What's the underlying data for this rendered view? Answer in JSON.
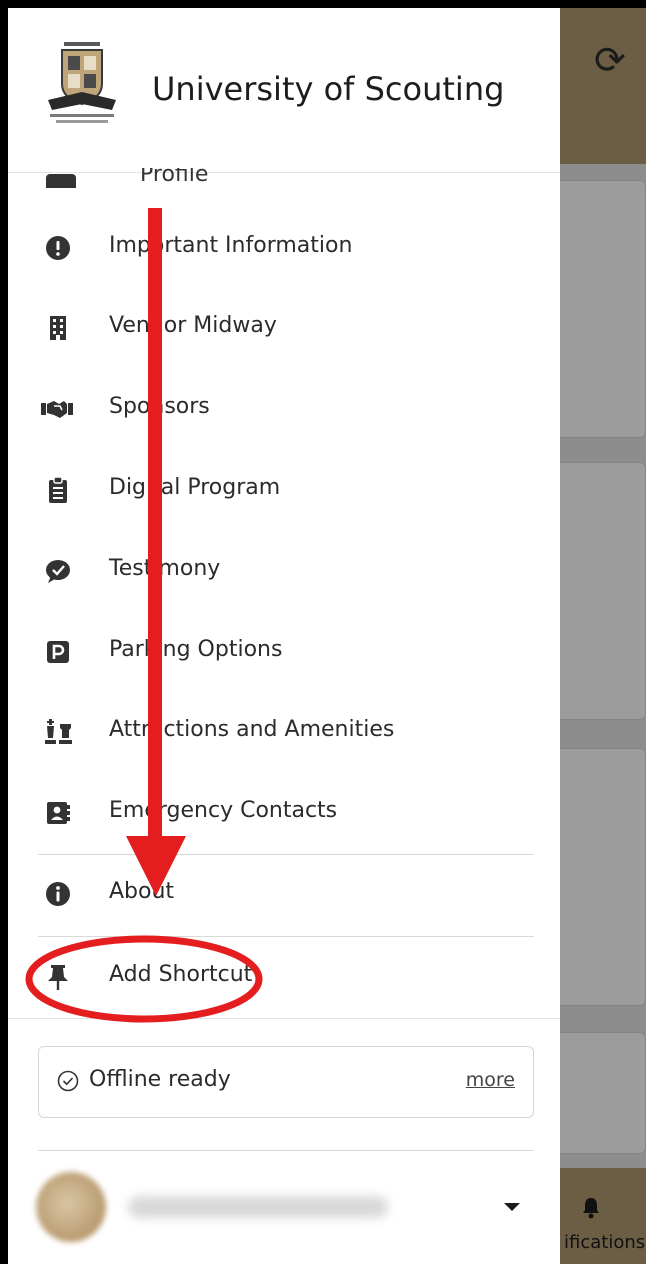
{
  "app": {
    "title": "University of Scouting",
    "refresh_icon": "refresh-icon",
    "bottom_nav_label": "ifications",
    "bottom_nav_icon": "bell-icon"
  },
  "drawer": {
    "partial_item_label": "Profile",
    "items": [
      {
        "label": "Important Information",
        "icon": "exclamation-circle-icon"
      },
      {
        "label": "Vendor Midway",
        "icon": "building-icon"
      },
      {
        "label": "Sponsors",
        "icon": "handshake-icon"
      },
      {
        "label": "Digital Program",
        "icon": "clipboard-list-icon"
      },
      {
        "label": "Testimony",
        "icon": "comment-check-icon"
      },
      {
        "label": "Parking Options",
        "icon": "parking-icon"
      },
      {
        "label": "Attractions and Amenities",
        "icon": "chess-icon"
      },
      {
        "label": "Emergency Contacts",
        "icon": "address-card-icon"
      },
      {
        "label": "About",
        "icon": "info-circle-icon"
      },
      {
        "label": "Add Shortcut",
        "icon": "thumbtack-icon"
      }
    ],
    "offline": {
      "label": "Offline ready",
      "more_label": "more"
    }
  },
  "annotation": {
    "color": "#e41e1e"
  }
}
